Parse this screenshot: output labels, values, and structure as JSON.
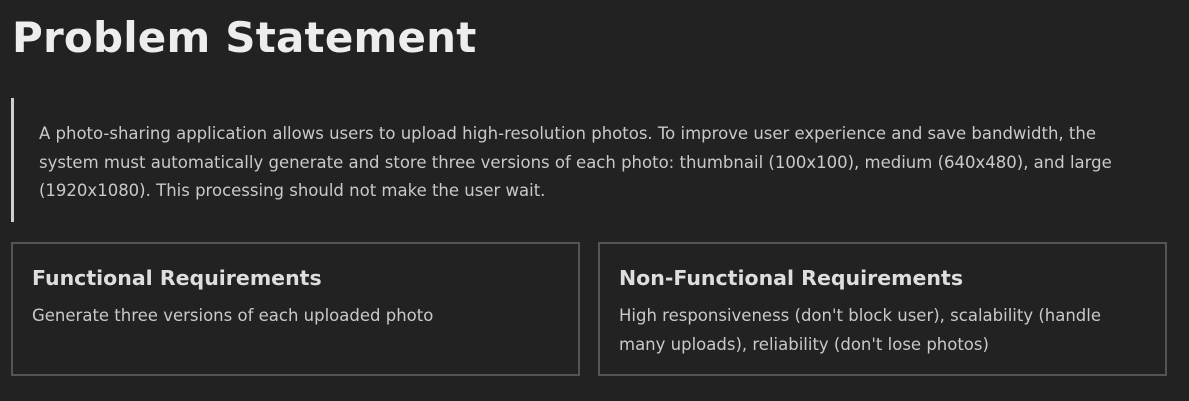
{
  "header": {
    "title": "Problem Statement"
  },
  "problem": {
    "text": "A photo-sharing application allows users to upload high-resolution photos. To improve user experience and save bandwidth, the system must automatically generate and store three versions of each photo: thumbnail (100x100), medium (640x480), and large (1920x1080). This processing should not make the user wait."
  },
  "cards": [
    {
      "title": "Functional Requirements",
      "body": "Generate three versions of each uploaded photo"
    },
    {
      "title": "Non-Functional Requirements",
      "body": "High responsiveness (don't block user), scalability (handle many uploads), reliability (don't lose photos)"
    }
  ],
  "colors": {
    "background": "#222222",
    "border": "#555555",
    "quote_bar": "#cfcfcf"
  }
}
